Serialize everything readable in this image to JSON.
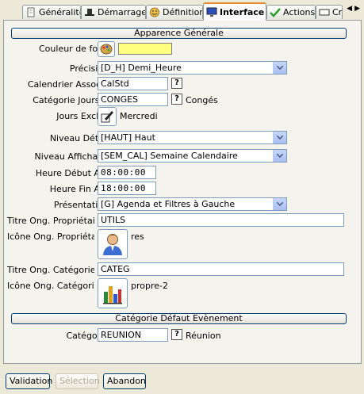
{
  "tabs": [
    {
      "label": "Généralités",
      "icon": "document-icon"
    },
    {
      "label": "Démarrage",
      "icon": "hat-icon"
    },
    {
      "label": "Définition",
      "icon": "face-icon"
    },
    {
      "label": "Interface",
      "icon": "monitor-icon"
    },
    {
      "label": "Actions",
      "icon": "checkmark-icon"
    },
    {
      "label": "Cr",
      "icon": "field-icon"
    }
  ],
  "sections": {
    "general": "Apparence Générale",
    "event": "Catégorie Défaut Evènement"
  },
  "form": {
    "bg_color": {
      "label": "Couleur de fond",
      "value": "#ffff80"
    },
    "precision": {
      "label": "Précision",
      "value": "[D_H] Demi_Heure"
    },
    "calendar": {
      "label": "Calendrier Associé",
      "value": "CalStd",
      "help": "?"
    },
    "holiday_category": {
      "label": "Catégorie Jours F.",
      "value": "CONGES",
      "help": "?",
      "desc": "Congés"
    },
    "excluded_days": {
      "label": "Jours Exclus",
      "value": "Mercredi"
    },
    "detail_level": {
      "label": "Niveau Détail",
      "value": "[HAUT] Haut"
    },
    "display_level": {
      "label": "Niveau Affichage",
      "value": "[SEM_CAL] Semaine Calendaire"
    },
    "start_time": {
      "label": "Heure Début Aff.",
      "value": "08:00:00"
    },
    "end_time": {
      "label": "Heure Fin Aff.",
      "value": "18:00:00"
    },
    "presentation": {
      "label": "Présentation",
      "value": "[G] Agenda et Filtres à Gauche"
    },
    "owner_tab_title": {
      "label": "Titre Ong. Propriétair··",
      "value": "UTILS"
    },
    "owner_tab_icon": {
      "label": "Icône Ong. Propriétair··",
      "value": "res"
    },
    "categories_tab_title": {
      "label": "Titre Ong. Catégories",
      "value": "CATEG"
    },
    "categories_tab_icon": {
      "label": "Icône Ong. Catégori··",
      "value": "propre-2"
    },
    "event_category": {
      "label": "Catégorie",
      "value": "REUNION",
      "help": "?",
      "desc": "Réunion"
    }
  },
  "buttons": {
    "validate": "Validation",
    "selection": "Sélection",
    "cancel": "Abandon"
  },
  "colors": {
    "accent": "#e68b2c",
    "field_border": "#7f9db9",
    "swatch": "#ffff80"
  }
}
